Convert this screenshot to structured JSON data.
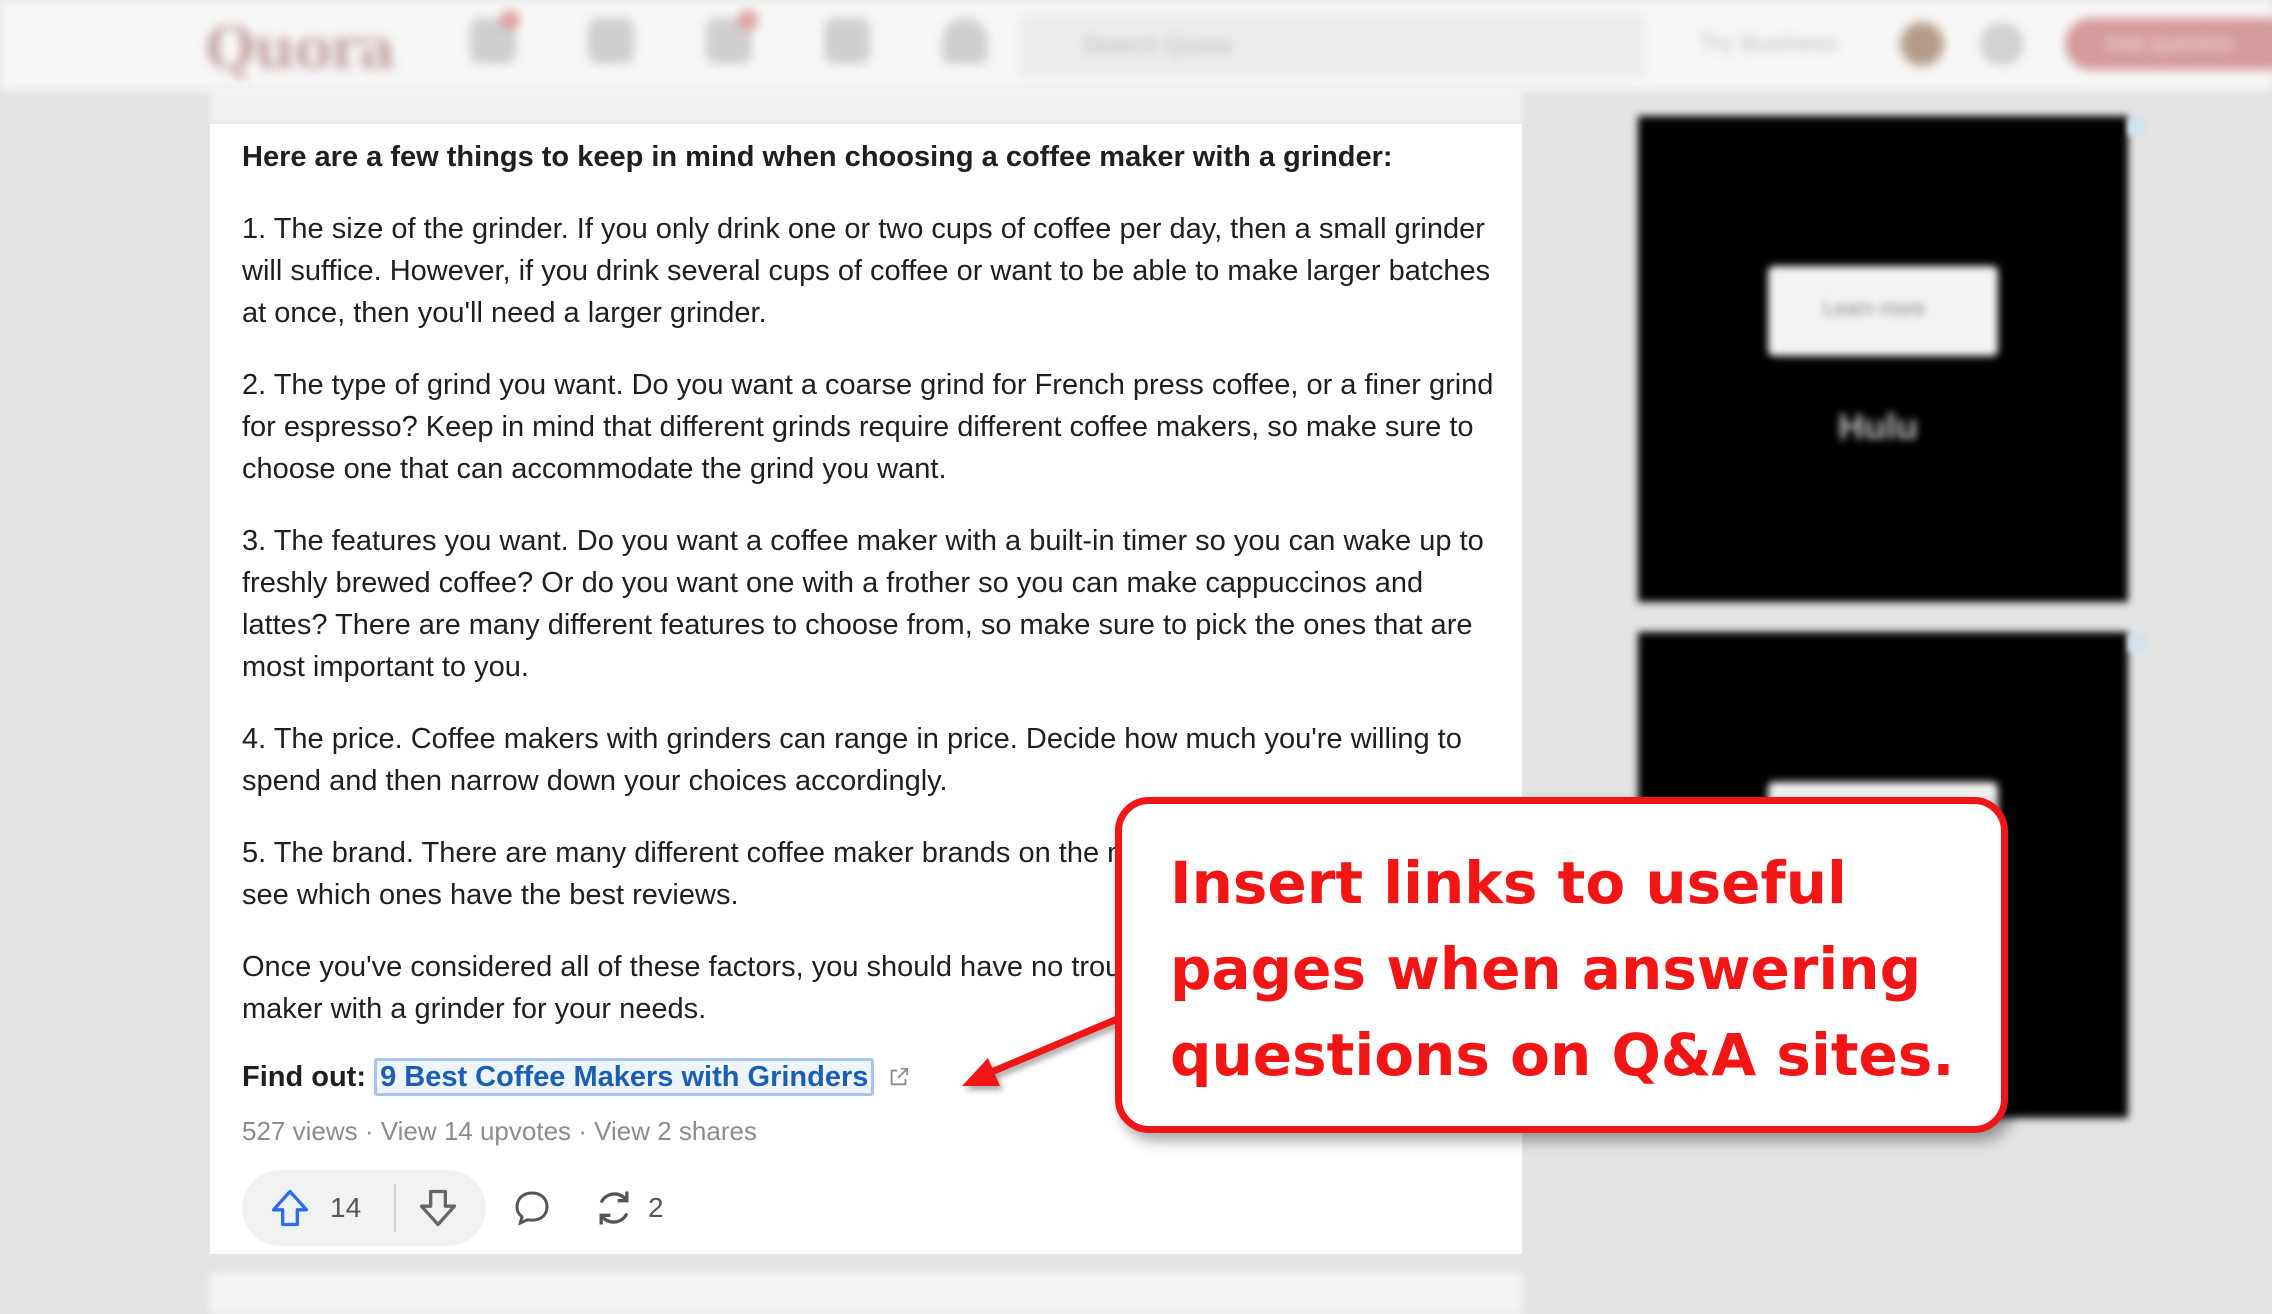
{
  "nav": {
    "logo": "Quora",
    "search_placeholder": "Search Quora",
    "try_business": "Try Business",
    "add_question": "Add question"
  },
  "answer": {
    "lead": "Here are a few things to keep in mind when choosing a coffee maker with a grinder:",
    "paragraphs": [
      "1. The size of the grinder. If you only drink one or two cups of coffee per day, then a small grinder will suffice. However, if you drink several cups of coffee or want to be able to make larger batches at once, then you'll need a larger grinder.",
      "2. The type of grind you want. Do you want a coarse grind for French press coffee, or a finer grind for espresso? Keep in mind that different grinds require different coffee makers, so make sure to choose one that can accommodate the grind you want.",
      "3. The features you want. Do you want a coffee maker with a built-in timer so you can wake up to freshly brewed coffee? Or do you want one with a frother so you can make cappuccinos and lattes? There are many different features to choose from, so make sure to pick the ones that are most important to you.",
      "4. The price. Coffee makers with grinders can range in price. Decide how much you're willing to spend and then narrow down your choices accordingly.",
      "5. The brand. There are many different coffee maker brands on the market. Do some research to see which ones have the best reviews.",
      "Once you've considered all of these factors, you should have no trouble finding the perfect coffee maker with a grinder for your needs."
    ],
    "find_label": "Find out:",
    "find_link": "9 Best Coffee Makers with Grinders",
    "stats": "527 views · View 14 upvotes · View 2 shares",
    "upvotes": "14",
    "shares": "2"
  },
  "ads": {
    "button_label": "Learn more",
    "brand_text": "Hulu"
  },
  "callout": {
    "text": "Insert links to useful pages when answering questions on Q&A sites.",
    "color": "#f11515"
  },
  "colors": {
    "link": "#1a5fb4",
    "accent": "#f11515"
  }
}
